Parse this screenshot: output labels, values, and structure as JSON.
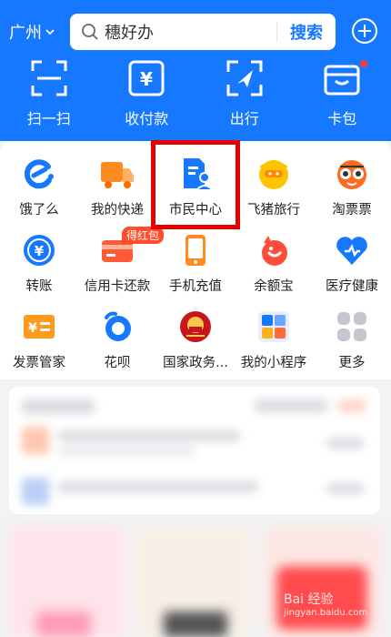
{
  "header": {
    "city": "广州",
    "search_placeholder": "穗好办",
    "search_button": "搜索"
  },
  "quick_actions": [
    {
      "label": "扫一扫",
      "icon": "scan-icon"
    },
    {
      "label": "收付款",
      "icon": "payment-icon"
    },
    {
      "label": "出行",
      "icon": "travel-icon"
    },
    {
      "label": "卡包",
      "icon": "card-wallet-icon"
    }
  ],
  "grid": [
    {
      "label": "饿了么",
      "icon": "eleme-icon"
    },
    {
      "label": "我的快递",
      "icon": "delivery-truck-icon"
    },
    {
      "label": "市民中心",
      "icon": "citizen-center-icon"
    },
    {
      "label": "飞猪旅行",
      "icon": "fliggy-icon"
    },
    {
      "label": "淘票票",
      "icon": "taopiaopiao-icon"
    },
    {
      "label": "转账",
      "icon": "transfer-icon"
    },
    {
      "label": "信用卡还款",
      "icon": "credit-card-icon",
      "badge": "得红包"
    },
    {
      "label": "手机充值",
      "icon": "phone-recharge-icon"
    },
    {
      "label": "余额宝",
      "icon": "yuebao-icon"
    },
    {
      "label": "医疗健康",
      "icon": "medical-health-icon"
    },
    {
      "label": "发票管家",
      "icon": "invoice-icon"
    },
    {
      "label": "花呗",
      "icon": "huabei-icon"
    },
    {
      "label": "国家政务...",
      "icon": "national-gov-icon"
    },
    {
      "label": "我的小程序",
      "icon": "mini-programs-icon"
    },
    {
      "label": "更多",
      "icon": "more-icon"
    }
  ],
  "watermark": {
    "brand": "Bai 经验",
    "url": "jingyan.baidu.com"
  },
  "colors": {
    "brand": "#1677ff",
    "highlight": "#e60000"
  }
}
